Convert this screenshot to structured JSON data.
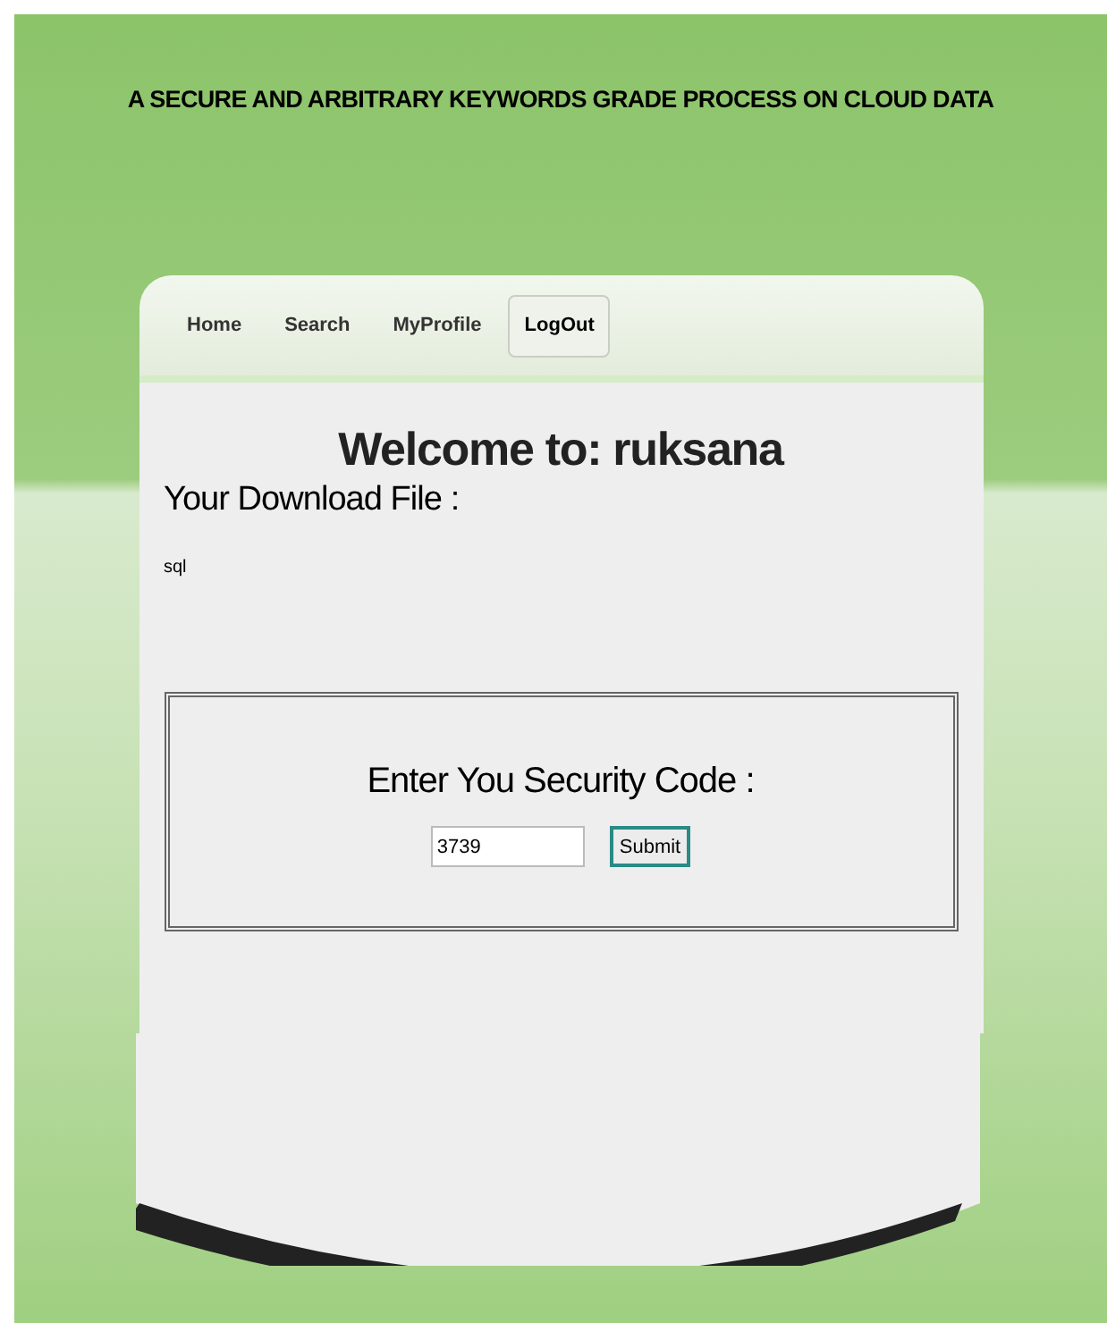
{
  "header": {
    "title": "A SECURE AND ARBITRARY KEYWORDS GRADE PROCESS ON CLOUD DATA"
  },
  "nav": [
    {
      "label": "Home",
      "selected": false
    },
    {
      "label": "Search",
      "selected": false
    },
    {
      "label": "MyProfile",
      "selected": false
    },
    {
      "label": "LogOut",
      "selected": true
    }
  ],
  "welcome": "Welcome to: ruksana",
  "download_label": "Your Download File :",
  "file_name": "sql",
  "security": {
    "label": "Enter You Security Code :",
    "value": "3739",
    "button": "Submit"
  }
}
